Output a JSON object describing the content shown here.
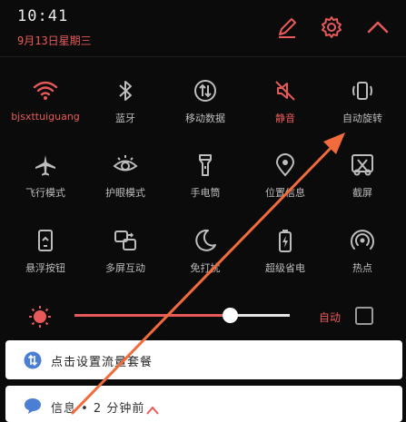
{
  "status": {
    "time": "10:41",
    "date": "9月13日星期三"
  },
  "header": {
    "icons": [
      "edit-icon",
      "settings-icon",
      "collapse-icon"
    ]
  },
  "tiles": [
    {
      "label": "bjsxttuiguang",
      "icon": "wifi-icon",
      "active": true
    },
    {
      "label": "蓝牙",
      "icon": "bluetooth-icon",
      "active": false
    },
    {
      "label": "移动数据",
      "icon": "mobile-data-icon",
      "active": false
    },
    {
      "label": "静音",
      "icon": "mute-icon",
      "active": true
    },
    {
      "label": "自动旋转",
      "icon": "auto-rotate-icon",
      "active": false
    },
    {
      "label": "飞行模式",
      "icon": "airplane-icon",
      "active": false
    },
    {
      "label": "护眼模式",
      "icon": "eye-icon",
      "active": false
    },
    {
      "label": "手电筒",
      "icon": "flashlight-icon",
      "active": false
    },
    {
      "label": "位置信息",
      "icon": "location-icon",
      "active": false
    },
    {
      "label": "截屏",
      "icon": "screenshot-icon",
      "active": false
    },
    {
      "label": "悬浮按钮",
      "icon": "floating-button-icon",
      "active": false
    },
    {
      "label": "多屏互动",
      "icon": "multi-screen-icon",
      "active": false
    },
    {
      "label": "免打扰",
      "icon": "do-not-disturb-icon",
      "active": false
    },
    {
      "label": "超级省电",
      "icon": "power-saving-icon",
      "active": false
    },
    {
      "label": "热点",
      "icon": "hotspot-icon",
      "active": false
    }
  ],
  "brightness": {
    "level": 0.72,
    "auto_label": "自动",
    "auto_checked": false
  },
  "notifications": {
    "data_plan": "点击设置流量套餐",
    "message": "信息 • 2 分钟前"
  },
  "colors": {
    "accent": "#e85a5a",
    "arrow": "#f26b3a"
  }
}
